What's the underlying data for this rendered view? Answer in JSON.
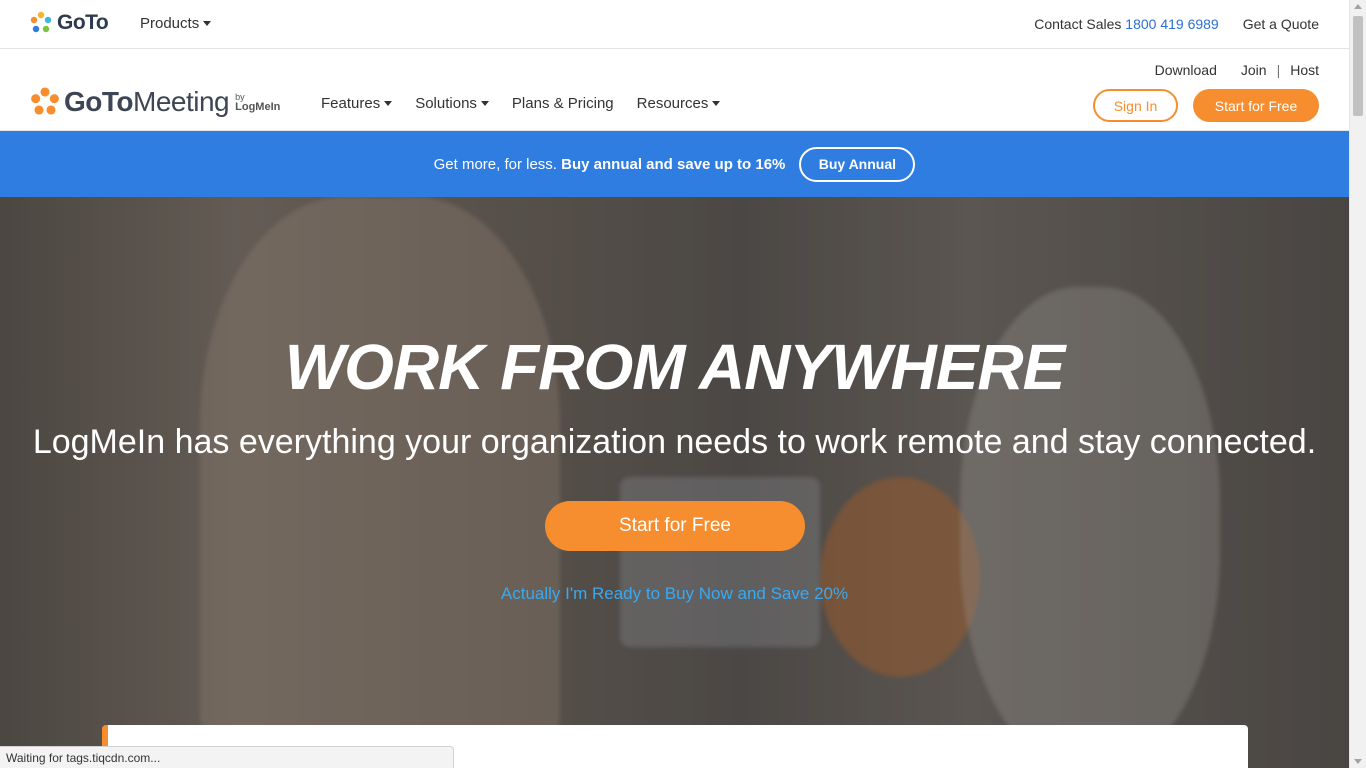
{
  "topbar": {
    "brand": "GoTo",
    "products_label": "Products",
    "contact_label": "Contact Sales",
    "contact_phone": "1800 419 6989",
    "quote_label": "Get a Quote"
  },
  "prodnav": {
    "brand_bold": "GoTo",
    "brand_rest": "Meeting",
    "by_label": "by",
    "by_brand": "LogMeIn",
    "items": [
      {
        "label": "Features"
      },
      {
        "label": "Solutions"
      },
      {
        "label": "Plans & Pricing"
      },
      {
        "label": "Resources"
      }
    ],
    "download_label": "Download",
    "join_label": "Join",
    "host_label": "Host",
    "signin_label": "Sign In",
    "start_label": "Start for Free"
  },
  "promo": {
    "text": "Get more, for less.",
    "text_bold": "Buy annual and save up to 16%",
    "button_label": "Buy Annual"
  },
  "hero": {
    "title": "WORK FROM ANYWHERE",
    "subtitle": "LogMeIn has everything your organization needs to work remote and stay connected.",
    "cta_label": "Start for Free",
    "buy_link": "Actually I'm Ready to Buy Now and Save 20%"
  },
  "status": {
    "text": "Waiting for tags.tiqcdn.com..."
  },
  "colors": {
    "accent_orange": "#f68d2e",
    "promo_blue": "#2f7de1",
    "link_blue": "#3aa9f0"
  }
}
